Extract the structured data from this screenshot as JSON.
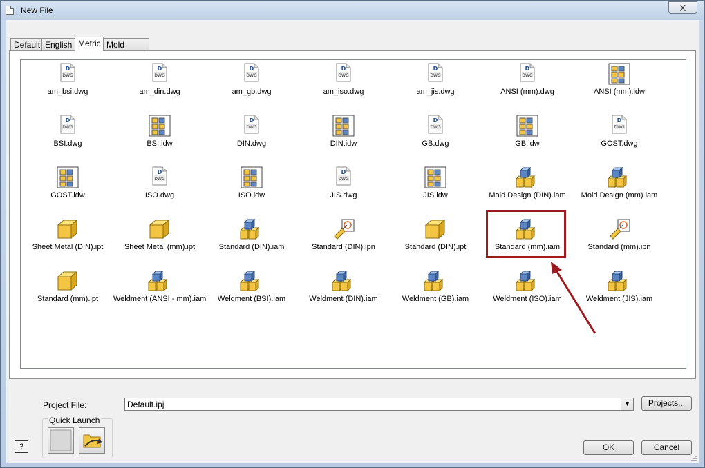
{
  "window": {
    "title": "New File",
    "close_symbol": "X"
  },
  "tabs": [
    {
      "label": "Default",
      "active": false
    },
    {
      "label": "English",
      "active": false
    },
    {
      "label": "Metric",
      "active": true
    },
    {
      "label": "Mold Design",
      "active": false
    }
  ],
  "files": [
    {
      "label": "am_bsi.dwg",
      "icon": "dwg-icon"
    },
    {
      "label": "am_din.dwg",
      "icon": "dwg-icon"
    },
    {
      "label": "am_gb.dwg",
      "icon": "dwg-icon"
    },
    {
      "label": "am_iso.dwg",
      "icon": "dwg-icon"
    },
    {
      "label": "am_jis.dwg",
      "icon": "dwg-icon"
    },
    {
      "label": "ANSI (mm).dwg",
      "icon": "dwg-icon"
    },
    {
      "label": "ANSI (mm).idw",
      "icon": "idw-icon"
    },
    {
      "label": "BSI.dwg",
      "icon": "dwg-icon"
    },
    {
      "label": "BSI.idw",
      "icon": "idw-icon"
    },
    {
      "label": "DIN.dwg",
      "icon": "dwg-icon"
    },
    {
      "label": "DIN.idw",
      "icon": "idw-icon"
    },
    {
      "label": "GB.dwg",
      "icon": "dwg-icon"
    },
    {
      "label": "GB.idw",
      "icon": "idw-icon"
    },
    {
      "label": "GOST.dwg",
      "icon": "dwg-icon"
    },
    {
      "label": "GOST.idw",
      "icon": "idw-icon"
    },
    {
      "label": "ISO.dwg",
      "icon": "dwg-icon"
    },
    {
      "label": "ISO.idw",
      "icon": "idw-icon"
    },
    {
      "label": "JIS.dwg",
      "icon": "dwg-icon"
    },
    {
      "label": "JIS.idw",
      "icon": "idw-icon"
    },
    {
      "label": "Mold Design (DIN).iam",
      "icon": "assembly-icon"
    },
    {
      "label": "Mold Design (mm).iam",
      "icon": "assembly-icon"
    },
    {
      "label": "Sheet Metal (DIN).ipt",
      "icon": "part-icon"
    },
    {
      "label": "Sheet Metal (mm).ipt",
      "icon": "part-icon"
    },
    {
      "label": "Standard (DIN).iam",
      "icon": "assembly-icon"
    },
    {
      "label": "Standard (DIN).ipn",
      "icon": "presentation-icon"
    },
    {
      "label": "Standard (DIN).ipt",
      "icon": "part-icon"
    },
    {
      "label": "Standard (mm).iam",
      "icon": "assembly-icon",
      "selected": true
    },
    {
      "label": "Standard (mm).ipn",
      "icon": "presentation-icon"
    },
    {
      "label": "Standard (mm).ipt",
      "icon": "part-icon"
    },
    {
      "label": "Weldment (ANSI - mm).iam",
      "icon": "assembly-icon"
    },
    {
      "label": "Weldment (BSI).iam",
      "icon": "assembly-icon"
    },
    {
      "label": "Weldment (DIN).iam",
      "icon": "assembly-icon"
    },
    {
      "label": "Weldment (GB).iam",
      "icon": "assembly-icon"
    },
    {
      "label": "Weldment (ISO).iam",
      "icon": "assembly-icon"
    },
    {
      "label": "Weldment (JIS).iam",
      "icon": "assembly-icon"
    }
  ],
  "project": {
    "label": "Project File:",
    "value": "Default.ipj",
    "projects_button": "Projects..."
  },
  "quick_launch": {
    "label": "Quick Launch",
    "buttons": [
      "new-file-icon",
      "open-folder-icon"
    ]
  },
  "footer": {
    "ok": "OK",
    "cancel": "Cancel",
    "help": "?"
  },
  "colors": {
    "highlight": "#9b1b1f",
    "arrow": "#9b1b1f"
  }
}
